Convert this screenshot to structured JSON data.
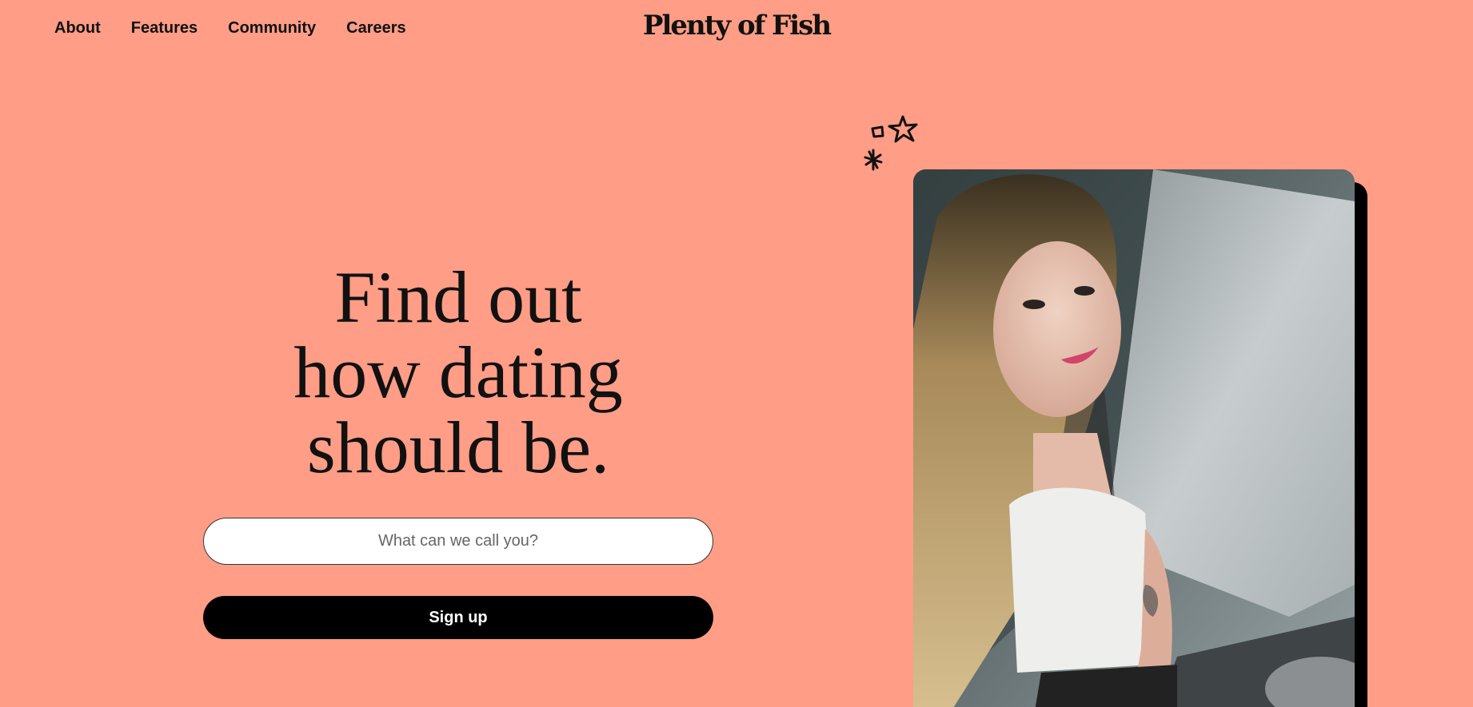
{
  "nav": {
    "items": [
      {
        "label": "About"
      },
      {
        "label": "Features"
      },
      {
        "label": "Community"
      },
      {
        "label": "Careers"
      }
    ]
  },
  "brand": {
    "logo": "Plenty of Fish"
  },
  "hero": {
    "headline_line1": "Find out",
    "headline_line2": "how dating",
    "headline_line3": "should be.",
    "name_placeholder": "What can we call you?",
    "signup_label": "Sign up"
  },
  "colors": {
    "background": "#ff9d86",
    "button": "#000000",
    "text": "#111111"
  },
  "icons": [
    "sparkle-doodle-icon"
  ]
}
